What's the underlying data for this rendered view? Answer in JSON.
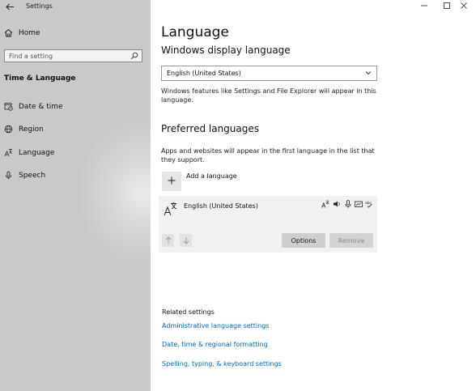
{
  "window": {
    "app_title": "Settings",
    "back_icon": "back-arrow-icon",
    "controls": [
      "minimize-icon",
      "maximize-icon",
      "close-icon"
    ]
  },
  "sidebar": {
    "home_label": "Home",
    "search_placeholder": "Find a setting",
    "section_title": "Time & Language",
    "items": [
      {
        "label": "Date & time",
        "icon": "calendar-clock-icon"
      },
      {
        "label": "Region",
        "icon": "globe-icon"
      },
      {
        "label": "Language",
        "icon": "language-icon"
      },
      {
        "label": "Speech",
        "icon": "microphone-icon"
      }
    ]
  },
  "main": {
    "page_title": "Language",
    "display_language": {
      "heading": "Windows display language",
      "selected": "English (United States)",
      "description": "Windows features like Settings and File Explorer will appear in this language."
    },
    "preferred": {
      "heading": "Preferred languages",
      "description": "Apps and websites will appear in the first language in the list that they support.",
      "add_label": "Add a language",
      "languages": [
        {
          "name": "English (United States)",
          "feature_icons": [
            "display-language-icon",
            "text-to-speech-icon",
            "speech-recognition-icon",
            "handwriting-icon",
            "spellcheck-icon"
          ],
          "options_label": "Options",
          "remove_label": "Remove"
        }
      ]
    },
    "related": {
      "heading": "Related settings",
      "links": [
        "Administrative language settings",
        "Date, time & regional formatting",
        "Spelling, typing, & keyboard settings"
      ]
    }
  },
  "colors": {
    "link": "#0067b8",
    "sidebar_bg": "#d8d8d8",
    "card_bg": "#f1f1f1"
  }
}
